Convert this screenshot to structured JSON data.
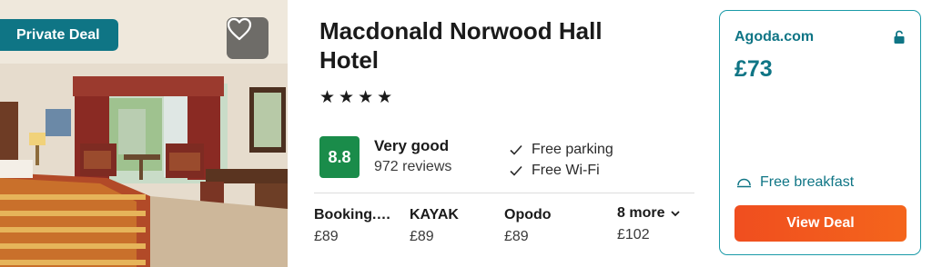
{
  "photo": {
    "badge": "Private Deal",
    "favorite_icon": "heart-outline-icon"
  },
  "hotel": {
    "name": "Macdonald Norwood Hall Hotel",
    "stars": 4,
    "star_glyph": "★",
    "score": "8.8",
    "rating_label": "Very good",
    "review_count": "972 reviews",
    "score_color": "#1a8c4a"
  },
  "amenities": [
    {
      "label": "Free parking",
      "icon": "check-icon"
    },
    {
      "label": "Free Wi-Fi",
      "icon": "check-icon"
    }
  ],
  "providers": [
    {
      "name": "Booking.…",
      "price": "£89"
    },
    {
      "name": "KAYAK",
      "price": "£89"
    },
    {
      "name": "Opodo",
      "price": "£89"
    },
    {
      "name": "8 more",
      "price": "£102",
      "icon": "chevron-down-icon"
    }
  ],
  "offer": {
    "site": "Agoda.com",
    "price": "£73",
    "lock_icon": "unlocked-padlock-icon",
    "breakfast": "Free breakfast",
    "breakfast_icon": "cloche-icon",
    "cta": "View Deal",
    "accent": "#0f7585",
    "cta_color": "#f04e1f"
  }
}
